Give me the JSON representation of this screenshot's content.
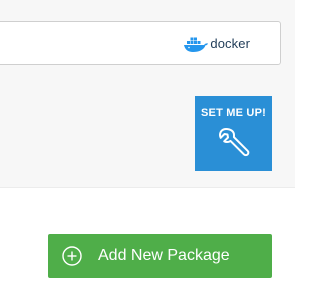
{
  "repository_field": {
    "package_type_logo": "docker-logo",
    "logo_text": "docker",
    "logo_color": "#1f3b57"
  },
  "set_me_up": {
    "label": "SET ME UP!",
    "icon": "wrench-icon",
    "background": "#2a8fd6"
  },
  "add_package": {
    "label": "Add New Package",
    "icon": "plus-circle-icon",
    "background": "#4fae49"
  }
}
